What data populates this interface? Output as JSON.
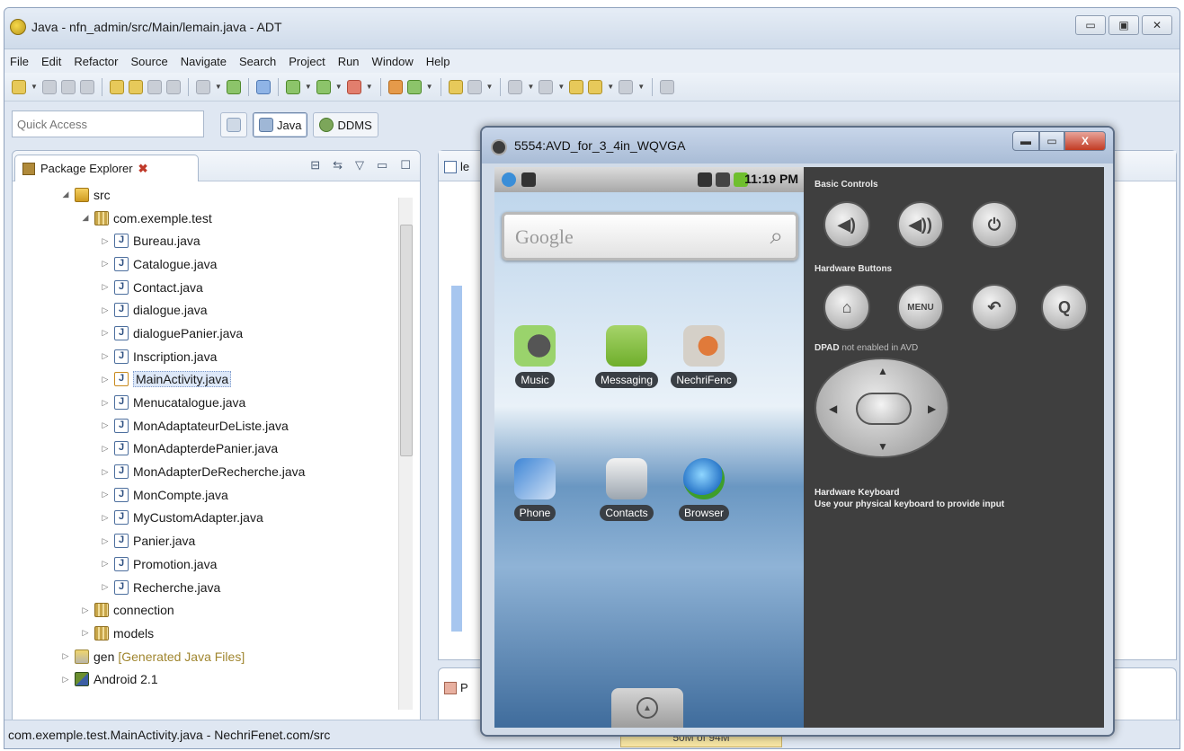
{
  "window": {
    "title": "Java - nfn_admin/src/Main/lemain.java - ADT",
    "buttons": [
      "▭",
      "▣",
      "✕"
    ]
  },
  "menu": [
    "File",
    "Edit",
    "Refactor",
    "Source",
    "Navigate",
    "Search",
    "Project",
    "Run",
    "Window",
    "Help"
  ],
  "quick_access": {
    "placeholder": "Quick Access"
  },
  "perspectives": {
    "java": "Java",
    "ddms": "DDMS"
  },
  "package_explorer": {
    "tab_title": "Package Explorer",
    "close": "✖",
    "view_tools": [
      "⊟",
      "⇆",
      "▽",
      "▭",
      "☐"
    ],
    "tree": [
      {
        "label": "src",
        "indent": 1,
        "icon": "src",
        "expanded": true
      },
      {
        "label": "com.exemple.test",
        "indent": 2,
        "icon": "pkg",
        "expanded": true
      },
      {
        "label": "Bureau.java",
        "indent": 3,
        "icon": "java"
      },
      {
        "label": "Catalogue.java",
        "indent": 3,
        "icon": "java"
      },
      {
        "label": "Contact.java",
        "indent": 3,
        "icon": "java"
      },
      {
        "label": "dialogue.java",
        "indent": 3,
        "icon": "java"
      },
      {
        "label": "dialoguePanier.java",
        "indent": 3,
        "icon": "java"
      },
      {
        "label": "Inscription.java",
        "indent": 3,
        "icon": "java"
      },
      {
        "label": "MainActivity.java",
        "indent": 3,
        "icon": "java-warning",
        "selected": true
      },
      {
        "label": "Menucatalogue.java",
        "indent": 3,
        "icon": "java"
      },
      {
        "label": "MonAdaptateurDeListe.java",
        "indent": 3,
        "icon": "java"
      },
      {
        "label": "MonAdapterdePanier.java",
        "indent": 3,
        "icon": "java"
      },
      {
        "label": "MonAdapterDeRecherche.java",
        "indent": 3,
        "icon": "java"
      },
      {
        "label": "MonCompte.java",
        "indent": 3,
        "icon": "java"
      },
      {
        "label": "MyCustomAdapter.java",
        "indent": 3,
        "icon": "java"
      },
      {
        "label": "Panier.java",
        "indent": 3,
        "icon": "java"
      },
      {
        "label": "Promotion.java",
        "indent": 3,
        "icon": "java"
      },
      {
        "label": "Recherche.java",
        "indent": 3,
        "icon": "java"
      },
      {
        "label": "connection",
        "indent": 2,
        "icon": "pkg",
        "expanded": false
      },
      {
        "label": "models",
        "indent": 2,
        "icon": "pkg",
        "expanded": false
      },
      {
        "label": "gen",
        "suffix": "[Generated Java Files]",
        "indent": 1,
        "icon": "gen",
        "expanded": false
      },
      {
        "label": "Android 2.1",
        "indent": 1,
        "icon": "lib",
        "expanded": false
      }
    ]
  },
  "editor": {
    "tab_prefix": "le",
    "bottom_prefix": "P"
  },
  "status": {
    "text": "com.exemple.test.MainActivity.java - NechriFenet.com/src",
    "heap": "50M of 94M"
  },
  "emulator": {
    "title": "5554:AVD_for_3_4in_WQVGA",
    "buttons": [
      "▬",
      "▭",
      "X"
    ],
    "clock": "11:19 PM",
    "search_placeholder": "Google",
    "apps_row1": [
      "Music",
      "Messaging",
      "NechriFenc"
    ],
    "apps_row2": [
      "Phone",
      "Contacts",
      "Browser"
    ],
    "controls": {
      "basic": "Basic Controls",
      "hardware": "Hardware Buttons",
      "dpad_prefix": "DPAD",
      "dpad_suffix": "not enabled in AVD",
      "keyboard_title": "Hardware Keyboard",
      "keyboard_text": "Use your physical keyboard to provide input",
      "basic_buttons": [
        "◀)",
        "◀))",
        "⏻"
      ],
      "hardware_buttons": [
        "⌂",
        "MENU",
        "↶",
        "Q"
      ]
    }
  },
  "colors": {
    "accent": "#6f86a8",
    "emulator_panel": "#3f3f3f"
  }
}
